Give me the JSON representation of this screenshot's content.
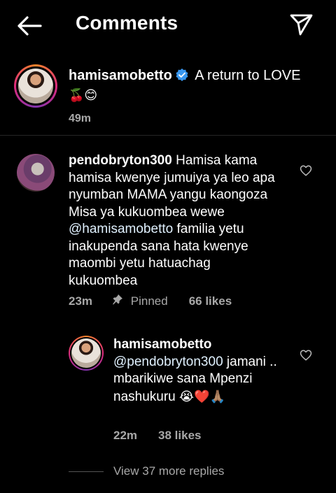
{
  "header": {
    "title": "Comments",
    "back_icon": "arrow-left-icon",
    "send_icon": "paper-plane-icon"
  },
  "caption": {
    "username": "hamisamobetto",
    "text": "A return to LOVE",
    "emojis": "🍒😊",
    "time": "49m"
  },
  "comments": [
    {
      "username": "pendobryton300",
      "text_before": "Hamisa kama hamisa kwenye jumuiya ya leo apa nyumban MAMA yangu kaongoza Misa ya kukuombea wewe",
      "mention": "@hamisamobetto",
      "text_after": "familia yetu inakupenda sana hata kwenye maombi yetu hatuachag kukuombea",
      "time": "23m",
      "pinned_label": "Pinned",
      "likes": "66 likes"
    }
  ],
  "reply": {
    "username": "hamisamobetto",
    "mention": "@pendobryton300",
    "text": "jamani .. mbarikiwe sana Mpenzi nashukuru",
    "emojis": "😭❤️🙏🏽",
    "time": "22m",
    "likes": "38 likes"
  },
  "more_replies": "View 37 more replies",
  "colors": {
    "background": "#000000",
    "secondary_text": "#a8a8a8",
    "verified_blue": "#3897f0",
    "divider": "#262626"
  }
}
